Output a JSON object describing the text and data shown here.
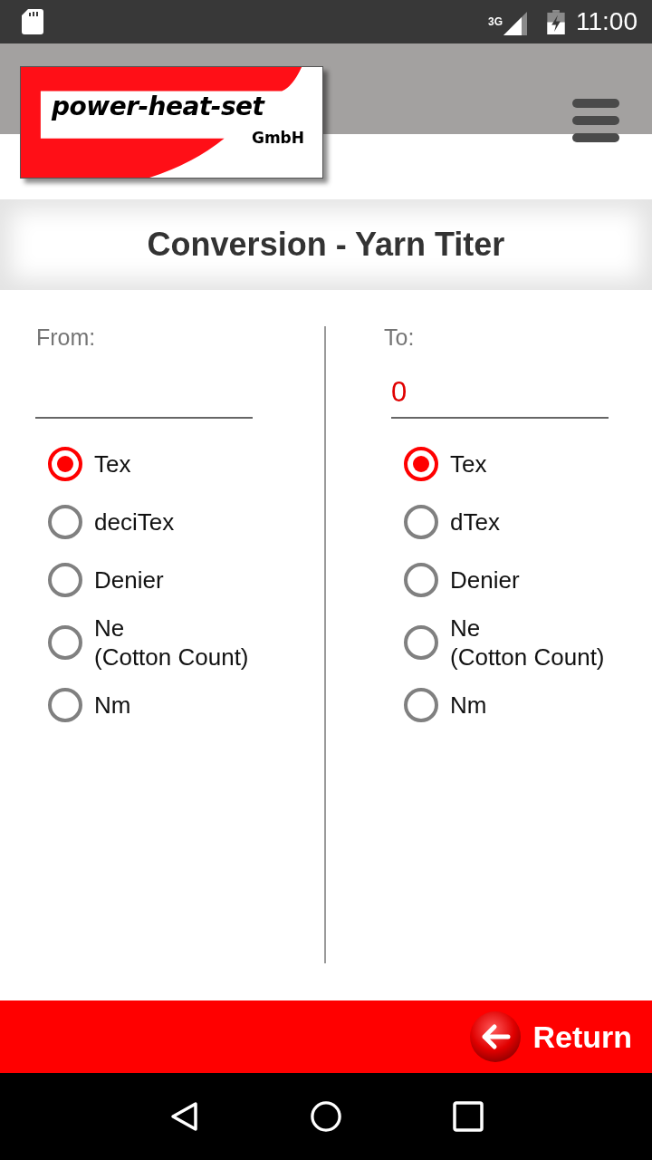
{
  "status_bar": {
    "network": "3G",
    "time": "11:00"
  },
  "header": {
    "logo": {
      "name": "power-heat-set",
      "suffix": "GmbH"
    }
  },
  "title": "Conversion - Yarn Titer",
  "columns": [
    {
      "label": "From:",
      "options": [
        {
          "label": "Tex",
          "selected": true
        },
        {
          "label": "deciTex",
          "selected": false
        },
        {
          "label": "Denier",
          "selected": false
        },
        {
          "label": "Ne\n(Cotton Count)",
          "selected": false
        },
        {
          "label": "Nm",
          "selected": false
        }
      ]
    },
    {
      "label": "To:",
      "value": "0",
      "options": [
        {
          "label": "Tex",
          "selected": true
        },
        {
          "label": "dTex",
          "selected": false
        },
        {
          "label": "Denier",
          "selected": false
        },
        {
          "label": "Ne\n(Cotton Count)",
          "selected": false
        },
        {
          "label": "Nm",
          "selected": false
        }
      ]
    }
  ],
  "footer": {
    "return_button": "Return"
  }
}
